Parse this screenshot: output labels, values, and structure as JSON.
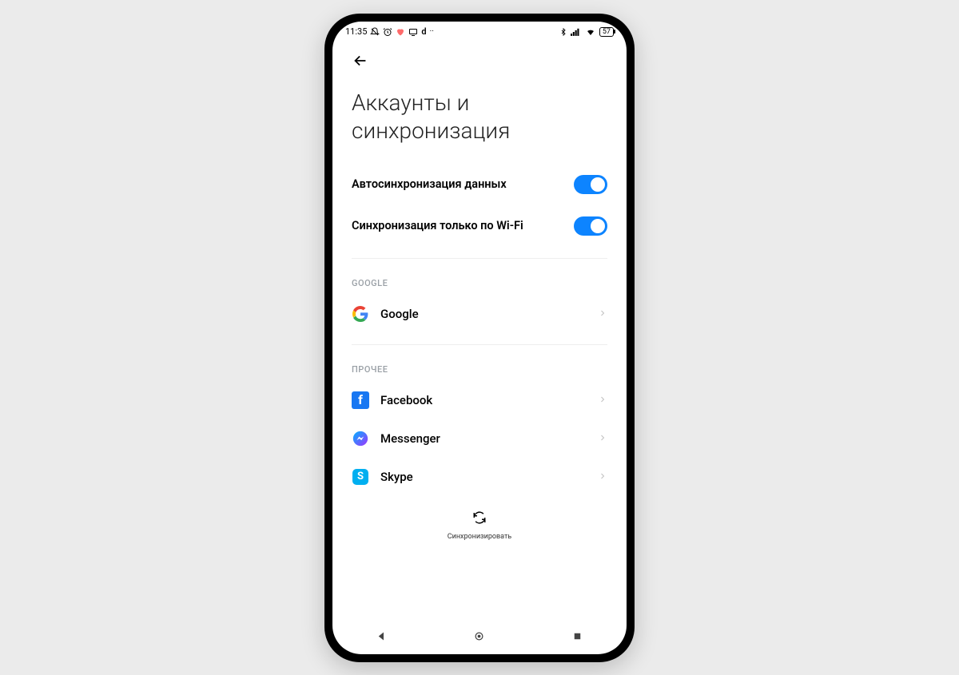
{
  "status": {
    "time": "11:35",
    "battery": "57"
  },
  "page": {
    "title": "Аккаунты и синхронизация"
  },
  "settings": {
    "autosync_label": "Автосинхронизация данных",
    "autosync_on": true,
    "wifi_only_label": "Синхронизация только по Wi-Fi",
    "wifi_only_on": true
  },
  "sections": {
    "google_header": "GOOGLE",
    "google_label": "Google",
    "other_header": "ПРОЧЕЕ",
    "facebook_label": "Facebook",
    "messenger_label": "Messenger",
    "skype_label": "Skype"
  },
  "sync_button": {
    "label": "Синхронизировать"
  }
}
